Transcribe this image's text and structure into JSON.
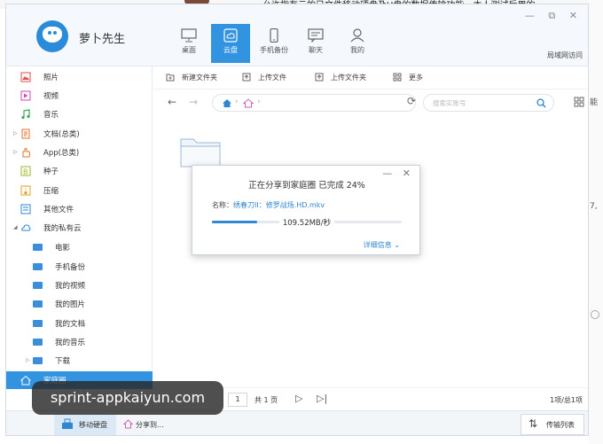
{
  "background": {
    "top_text": "允许指有云的已文件移动硬盘及U盘的数据传输功能，本人测试后用的",
    "right_text": [
      "能",
      "7,"
    ]
  },
  "app": {
    "name": "萝卜先生",
    "window_controls": "— ⧉ ✕",
    "lan_link": "局域网访问",
    "accent": "#3294e0",
    "nav": [
      {
        "label": "桌面",
        "icon": "monitor-icon"
      },
      {
        "label": "云盘",
        "icon": "cloud-disk-icon",
        "active": true
      },
      {
        "label": "手机备份",
        "icon": "phone-icon"
      },
      {
        "label": "聊天",
        "icon": "chat-icon"
      },
      {
        "label": "我的",
        "icon": "user-icon"
      }
    ]
  },
  "sidebar": {
    "items": [
      {
        "label": "照片",
        "icon": "photo-icon"
      },
      {
        "label": "视频",
        "icon": "video-icon"
      },
      {
        "label": "音乐",
        "icon": "music-icon"
      },
      {
        "label": "文档(总类)",
        "icon": "document-icon"
      },
      {
        "label": "App(总类)",
        "icon": "app-icon"
      },
      {
        "label": "种子",
        "icon": "seed-icon"
      },
      {
        "label": "压缩",
        "icon": "archive-icon"
      },
      {
        "label": "其他文件",
        "icon": "other-file-icon"
      },
      {
        "label": "我的私有云",
        "icon": "cloud-icon"
      },
      {
        "label": "电影",
        "icon": "folder-icon"
      },
      {
        "label": "手机备份",
        "icon": "folder-icon"
      },
      {
        "label": "我的视频",
        "icon": "folder-icon"
      },
      {
        "label": "我的图片",
        "icon": "folder-icon"
      },
      {
        "label": "我的文档",
        "icon": "folder-icon"
      },
      {
        "label": "我的音乐",
        "icon": "folder-icon"
      },
      {
        "label": "下载",
        "icon": "folder-icon"
      },
      {
        "label": "家庭圈",
        "icon": "home-icon",
        "active": true
      }
    ]
  },
  "toolbar": {
    "new_folder": "新建文件夹",
    "upload_file": "上传文件",
    "upload_folder": "上传文件夹",
    "more": "更多"
  },
  "search": {
    "placeholder": "搜索实账号"
  },
  "dialog": {
    "title": "正在分享到家庭圈 已完成 24%",
    "name_label": "名称：",
    "file_name": "绣春刀II：修罗战场.HD.mkv",
    "progress": 0.24,
    "speed": "109.52MB/秒",
    "detail_link": "详细信息",
    "controls": "— ✕"
  },
  "pagination": {
    "page": "1",
    "total": "共 1 页",
    "count": "1项/总1项"
  },
  "statusbar": {
    "mobile_disk": "移动硬盘",
    "share_to": "分享到...",
    "transfer_list": "传输列表"
  },
  "watermark": "sprint-appkaiyun.com"
}
